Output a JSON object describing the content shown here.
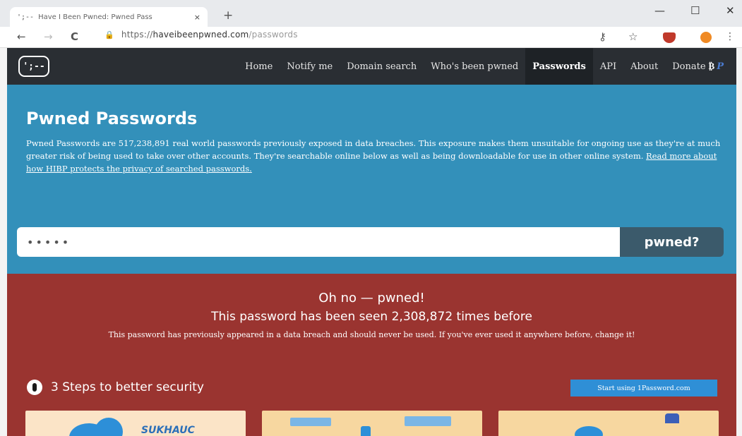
{
  "browser": {
    "tab": {
      "favicon_text": "';--",
      "title": "Have I Been Pwned: Pwned Pass",
      "close": "×"
    },
    "new_tab": "+",
    "window_controls": {
      "minimize": "—",
      "maximize": "☐",
      "close": "✕"
    },
    "nav": {
      "back": "←",
      "forward": "→",
      "reload": "C"
    },
    "url": {
      "lock": "🔒",
      "scheme": "https://",
      "host": "haveibeenpwned.com",
      "path": "/passwords"
    },
    "toolbar_icons": {
      "key": "⚷",
      "star": "☆",
      "menu": "⋮"
    },
    "extension_icon": "shield-extension",
    "profile_icon": "avatar"
  },
  "site": {
    "logo_text": "';--",
    "nav": [
      {
        "label": "Home"
      },
      {
        "label": "Notify me"
      },
      {
        "label": "Domain search"
      },
      {
        "label": "Who's been pwned"
      },
      {
        "label": "Passwords",
        "active": true
      },
      {
        "label": "API"
      },
      {
        "label": "About"
      },
      {
        "label": "Donate"
      }
    ],
    "donate_icons": {
      "bitcoin": "₿",
      "paypal": "P"
    }
  },
  "hero": {
    "title": "Pwned Passwords",
    "description": "Pwned Passwords are 517,238,891 real world passwords previously exposed in data breaches. This exposure makes them unsuitable for ongoing use as they're at much greater risk of being used to take over other accounts. They're searchable online below as well as being downloadable for use in other online system. ",
    "link": "Read more about how HIBP protects the privacy of searched passwords.",
    "search_value": "•••••",
    "search_button": "pwned?"
  },
  "result": {
    "heading": "Oh no — pwned!",
    "subheading": "This password has been seen 2,308,872 times before",
    "message": "This password has previously appeared in a data breach and should never be used. If you've ever used it anywhere before, change it!",
    "steps_title": "3 Steps to better security",
    "cta": "Start using 1Password.com",
    "card_text": "SUKHAUC"
  },
  "colors": {
    "nav_bg": "#2a2e33",
    "hero_bg": "#3390ba",
    "result_bg": "#9a3430",
    "button_bg": "#3b5a6b",
    "cta_bg": "#2f8fd6"
  }
}
